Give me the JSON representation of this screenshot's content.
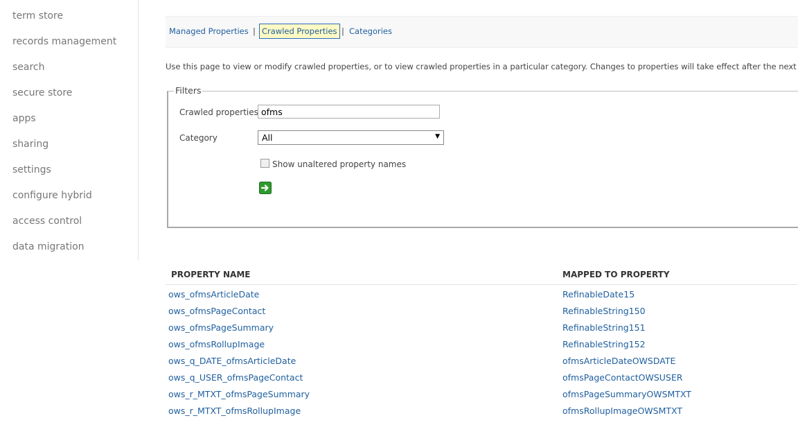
{
  "sidebar": {
    "items": [
      {
        "label": "term store"
      },
      {
        "label": "records management"
      },
      {
        "label": "search"
      },
      {
        "label": "secure store"
      },
      {
        "label": "apps"
      },
      {
        "label": "sharing"
      },
      {
        "label": "settings"
      },
      {
        "label": "configure hybrid"
      },
      {
        "label": "access control"
      },
      {
        "label": "data migration"
      }
    ]
  },
  "tabs": {
    "items": [
      {
        "label": "Managed Properties"
      },
      {
        "label": "Crawled Properties",
        "active": true
      },
      {
        "label": "Categories"
      }
    ],
    "separator": "|"
  },
  "description": "Use this page to view or modify crawled properties, or to view crawled properties in a particular category. Changes to properties will take effect after the next full crawl.",
  "filters": {
    "legend": "Filters",
    "crawled_label": "Crawled properties",
    "crawled_value": "ofms",
    "category_label": "Category",
    "category_value": "All",
    "checkbox_label": "Show unaltered property names",
    "checkbox_checked": false,
    "go_icon": "green-arrow-go-icon"
  },
  "table": {
    "columns": [
      "PROPERTY NAME",
      "MAPPED TO PROPERTY"
    ],
    "rows": [
      {
        "name": "ows_ofmsArticleDate",
        "mapped": "RefinableDate15"
      },
      {
        "name": "ows_ofmsPageContact",
        "mapped": "RefinableString150"
      },
      {
        "name": "ows_ofmsPageSummary",
        "mapped": "RefinableString151"
      },
      {
        "name": "ows_ofmsRollupImage",
        "mapped": "RefinableString152"
      },
      {
        "name": "ows_q_DATE_ofmsArticleDate",
        "mapped": "ofmsArticleDateOWSDATE"
      },
      {
        "name": "ows_q_USER_ofmsPageContact",
        "mapped": "ofmsPageContactOWSUSER"
      },
      {
        "name": "ows_r_MTXT_ofmsPageSummary",
        "mapped": "ofmsPageSummaryOWSMTXT"
      },
      {
        "name": "ows_r_MTXT_ofmsRollupImage",
        "mapped": "ofmsRollupImageOWSMTXT"
      }
    ]
  },
  "colors": {
    "link": "#1f5f9e",
    "active_tab_bg": "#fff9c4",
    "active_tab_border": "#2a6ebb",
    "nav_text": "#777777"
  }
}
